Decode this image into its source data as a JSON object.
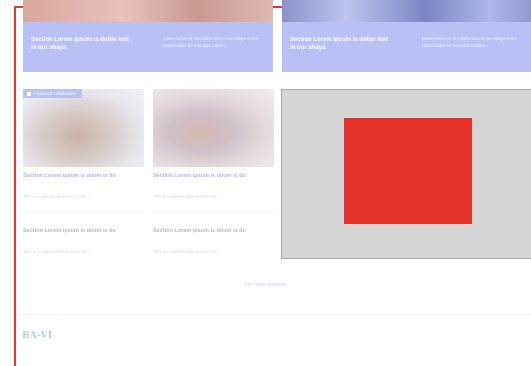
{
  "top_cards": [
    {
      "headline": "Section Lorem ipsum is dollar text in our shaya",
      "summary": "Ipsum lorem is the dollar text in our shaya is the placeholder for text and content"
    },
    {
      "headline": "Section Lorem ipsum is dollar text in our shaya",
      "summary": "Ipsum lorem is the dollar text in our shaya is the placeholder for text and content"
    }
  ],
  "thumb_badge": "Featured Celebration",
  "news_items": [
    {
      "title": "Section Lorem ipsum is doum is do",
      "desc": "This is a placeholder text for the..."
    },
    {
      "title": "Section Lorem ipsum is doum is do",
      "desc": "This is a placeholder text for the..."
    },
    {
      "title": "Section Lorem ipsum is doum is do",
      "desc": "This is a placeholder text for the..."
    },
    {
      "title": "Section Lorem ipsum is doum is do",
      "desc": "This is a placeholder text for the..."
    }
  ],
  "more_link": "Ler mais notícias",
  "section_logo": "BA-VI",
  "colors": {
    "accent_red": "#e3332b",
    "card_blue": "#b9c0f6",
    "ad_grey": "#d6d6d6",
    "logo_teal": "#a7d6d0"
  }
}
